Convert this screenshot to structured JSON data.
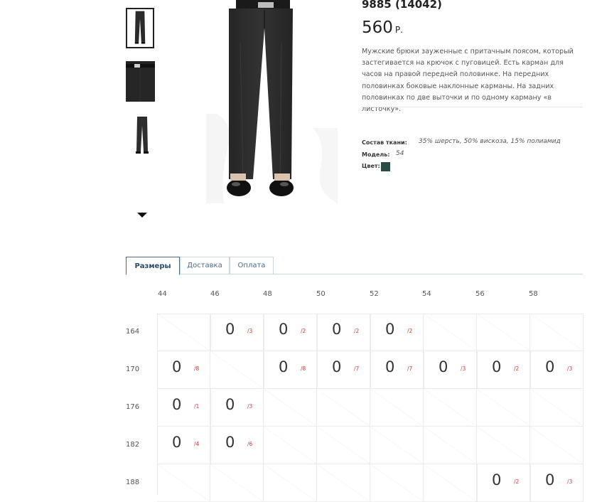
{
  "product": {
    "article": "9885 (14042)",
    "price": "560",
    "currency": "Р.",
    "description": "Мужские брюки зауженные с притачным поясом, который застегивается на крючок с пуговицей. Есть карман для часов на правой передней половинке. На передних половинках боковые наклонные карманы. На задних половинках по две выточки и по одному карману «в листочку».",
    "props": {
      "composition_label": "Состав ткани:",
      "composition_value": "35% шерсть, 50% вискоза, 15% полиамид",
      "model_label": "Модель:",
      "model_value": "54",
      "color_label": "Цвет:",
      "color_hex": "#2e4a44"
    }
  },
  "tabs": [
    {
      "label": "Размеры",
      "active": true
    },
    {
      "label": "Доставка",
      "active": false
    },
    {
      "label": "Оплата",
      "active": false
    }
  ],
  "sizes": {
    "columns": [
      "44",
      "46",
      "48",
      "50",
      "52",
      "54",
      "56",
      "58"
    ],
    "rows": [
      {
        "height": "164",
        "cells": [
          null,
          {
            "qty": "0",
            "stock": "/3"
          },
          {
            "qty": "0",
            "stock": "/2"
          },
          {
            "qty": "0",
            "stock": "/2"
          },
          {
            "qty": "0",
            "stock": "/2"
          },
          null,
          null,
          null
        ]
      },
      {
        "height": "170",
        "cells": [
          {
            "qty": "0",
            "stock": "/8"
          },
          null,
          {
            "qty": "0",
            "stock": "/8"
          },
          {
            "qty": "0",
            "stock": "/7"
          },
          {
            "qty": "0",
            "stock": "/7"
          },
          {
            "qty": "0",
            "stock": "/3"
          },
          {
            "qty": "0",
            "stock": "/2"
          },
          {
            "qty": "0",
            "stock": "/3"
          }
        ]
      },
      {
        "height": "176",
        "cells": [
          {
            "qty": "0",
            "stock": "/1"
          },
          {
            "qty": "0",
            "stock": "/3"
          },
          null,
          null,
          null,
          null,
          null,
          null
        ]
      },
      {
        "height": "182",
        "cells": [
          {
            "qty": "0",
            "stock": "/4"
          },
          {
            "qty": "0",
            "stock": "/6"
          },
          null,
          null,
          null,
          null,
          null,
          null
        ]
      },
      {
        "height": "188",
        "cells": [
          null,
          null,
          null,
          null,
          null,
          null,
          {
            "qty": "0",
            "stock": "/2"
          },
          {
            "qty": "0",
            "stock": "/3"
          }
        ]
      }
    ]
  },
  "colors": {
    "accent": "#4a6b8a",
    "stock_text": "#d43c3c"
  }
}
